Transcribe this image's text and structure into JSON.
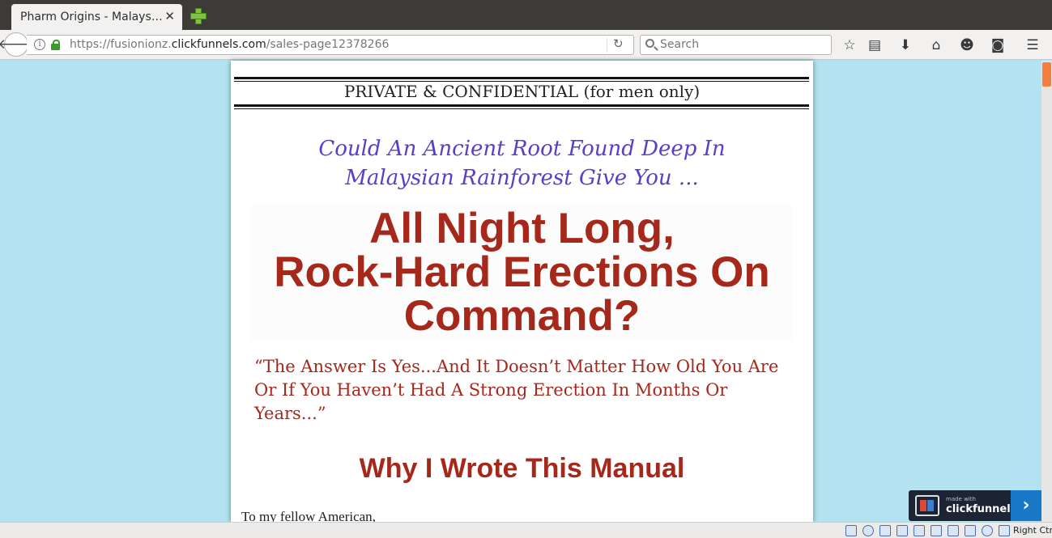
{
  "browser": {
    "tab_title": "Pharm Origins - Malays…",
    "url_prefix": "https://fusionionz.",
    "url_domain": "clickfunnels.com",
    "url_path": "/sales-page12378266",
    "search_placeholder": "Search"
  },
  "page": {
    "confidential": "PRIVATE & CONFIDENTIAL (for men only)",
    "subheadline_line1": "Could An Ancient Root Found Deep In",
    "subheadline_line2": "Malaysian Rainforest Give You ...",
    "headline_line1": "All Night Long,",
    "headline_line2": "Rock-Hard Erections On",
    "headline_line3": "Command?",
    "quote": "“The Answer Is Yes...And It Doesn’t Matter How Old You Are Or If You Haven’t Had A Strong Erection In Months Or Years...”",
    "section_heading": "Why I Wrote This Manual",
    "greeting": "To my fellow American,"
  },
  "badge": {
    "made_with": "made with",
    "brand": "clickfunnels"
  },
  "vm_status": {
    "host_key": "Right Ctrl"
  },
  "colors": {
    "page_background": "#b3e3f0",
    "headline_red": "#a5281b",
    "subheadline_purple": "#5b3ec8",
    "scroll_thumb": "#f47d40",
    "badge_blue": "#1a78c9"
  }
}
